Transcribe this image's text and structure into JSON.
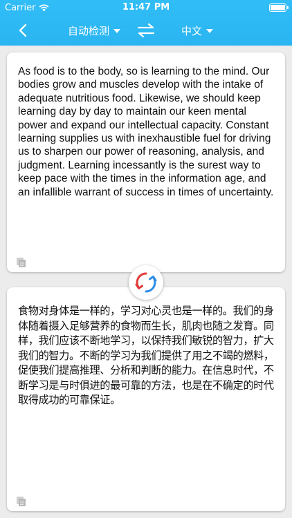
{
  "status_bar": {
    "carrier": "Carrier",
    "time": "11:47 PM"
  },
  "nav": {
    "source_language": "自动检测",
    "target_language": "中文"
  },
  "source_text": "As food is to the body, so is learning to the mind. Our bodies grow and muscles develop with the intake of adequate nutritious food. Likewise, we should keep learning day by day to maintain our keen mental power and expand our intellectual capacity. Constant learning supplies us with inexhaustible fuel for driving us to sharpen our power of reasoning, analysis, and judgment. Learning incessantly is the surest way to keep pace with the times in the information age, and an infallible warrant of success in times of uncertainty.",
  "translated_text": "食物对身体是一样的，学习对心灵也是一样的。我们的身体随着摄入足够营养的食物而生长，肌肉也随之发育。同样，我们应该不断地学习，以保持我们敏锐的智力，扩大我们的智力。不断的学习为我们提供了用之不竭的燃料，促使我们提高推理、分析和判断的能力。在信息时代，不断学习是与时俱进的最可靠的方法，也是在不确定的时代取得成功的可靠保证。",
  "colors": {
    "header": "#2ab5f2",
    "sync_red": "#e23b3b",
    "sync_blue": "#2f8ee5"
  }
}
